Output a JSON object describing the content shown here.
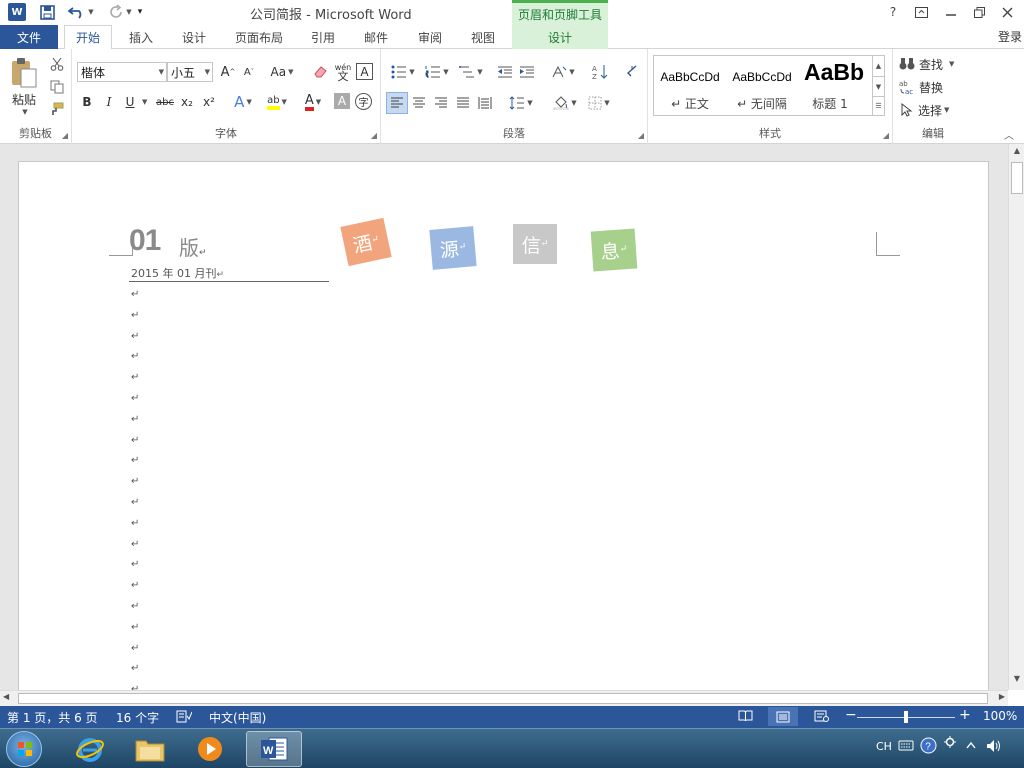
{
  "window": {
    "title": "公司简报 - Microsoft Word",
    "context_tab_group": "页眉和页脚工具",
    "app_icon": "W",
    "help": "?",
    "user": "登录"
  },
  "tabs": {
    "file": "文件",
    "home": "开始",
    "insert": "插入",
    "design": "设计",
    "layout": "页面布局",
    "references": "引用",
    "mailings": "邮件",
    "review": "审阅",
    "view": "视图",
    "hf_design": "设计"
  },
  "ribbon": {
    "clipboard": {
      "label": "剪贴板",
      "paste": "粘贴"
    },
    "font": {
      "label": "字体",
      "font_name": "楷体",
      "font_size": "小五",
      "change_case": "Aa",
      "phonetic": "wén",
      "phonetic_char": "文",
      "char_border": "A",
      "bold": "B",
      "italic": "I",
      "underline": "U",
      "strike": "abc",
      "subscript": "x₂",
      "superscript": "x²",
      "text_effect": "A",
      "highlight": "ab",
      "font_color": "A",
      "char_shading": "A",
      "enclose": "字"
    },
    "paragraph": {
      "label": "段落"
    },
    "styles": {
      "label": "样式",
      "items": [
        {
          "sample": "AaBbCcDd",
          "name": "↵ 正文"
        },
        {
          "sample": "AaBbCcDd",
          "name": "↵ 无间隔"
        },
        {
          "sample": "AaBb",
          "name": "标题 1"
        }
      ]
    },
    "editing": {
      "label": "编辑",
      "find": "查找",
      "replace": "替换",
      "select": "选择"
    }
  },
  "document": {
    "edition_num": "01",
    "edition_char": "版",
    "pub_date": "2015 年 01 月刊",
    "return_mark": "↵",
    "tiles": [
      {
        "char": "酒",
        "color": "#f2a57c"
      },
      {
        "char": "源",
        "color": "#9bb8e3"
      },
      {
        "char": "信",
        "color": "#c8c8c8"
      },
      {
        "char": "息",
        "color": "#a8d08d"
      }
    ]
  },
  "statusbar": {
    "page_info": "第 1 页，共 6 页",
    "word_count": "16 个字",
    "language": "中文(中国)",
    "zoom": "100%"
  },
  "taskbar": {
    "ime": "CH"
  },
  "colors": {
    "word_blue": "#2b579a",
    "context_green": "#1e7b34"
  }
}
